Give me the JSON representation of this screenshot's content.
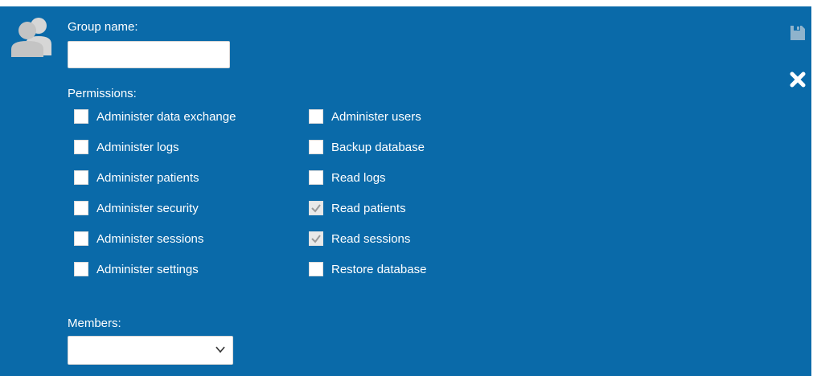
{
  "form": {
    "group_name_label": "Group name:",
    "group_name_value": "",
    "permissions_label": "Permissions:",
    "members_label": "Members:",
    "members_selected": ""
  },
  "permissions": {
    "left": [
      {
        "label": "Administer data exchange",
        "checked": false,
        "disabled": false
      },
      {
        "label": "Administer logs",
        "checked": false,
        "disabled": false
      },
      {
        "label": "Administer patients",
        "checked": false,
        "disabled": false
      },
      {
        "label": "Administer security",
        "checked": false,
        "disabled": false
      },
      {
        "label": "Administer sessions",
        "checked": false,
        "disabled": false
      },
      {
        "label": "Administer settings",
        "checked": false,
        "disabled": false
      }
    ],
    "right": [
      {
        "label": "Administer users",
        "checked": false,
        "disabled": false
      },
      {
        "label": "Backup database",
        "checked": false,
        "disabled": false
      },
      {
        "label": "Read logs",
        "checked": false,
        "disabled": false
      },
      {
        "label": "Read patients",
        "checked": true,
        "disabled": true
      },
      {
        "label": "Read sessions",
        "checked": true,
        "disabled": true
      },
      {
        "label": "Restore database",
        "checked": false,
        "disabled": false
      }
    ]
  },
  "icons": {
    "avatar": "group-users-icon",
    "save": "save-icon",
    "close": "close-icon",
    "dropdown": "chevron-down-icon"
  },
  "colors": {
    "panel_bg": "#0a6aa9",
    "text": "#ffffff",
    "avatar": "#c9c9c9",
    "save_disabled": "#8fb3cc"
  }
}
